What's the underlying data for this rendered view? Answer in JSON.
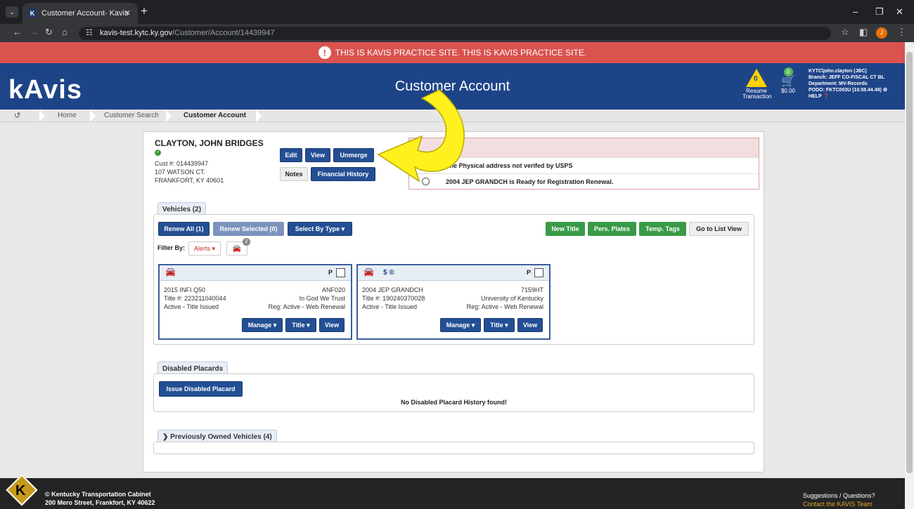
{
  "browser": {
    "tab_title": "Customer Account- Kavis",
    "tab_icon": "KAVIS",
    "url_domain": "kavis-test.kytc.ky.gov",
    "url_path": "/Customer/Account/14439947"
  },
  "banner": {
    "text": "THIS IS KAVIS PRACTICE SITE. THIS IS KAVIS PRACTICE SITE."
  },
  "header": {
    "logo": "kAvis",
    "title": "Customer Account",
    "resume_count": "0",
    "resume_label": "Resume Transaction",
    "cart_count": "0",
    "cart_total": "$0.00",
    "user_line1": "KYTC\\john.clayton (JBC)",
    "user_line2": "Branch: JEFF CO-FISCAL CT BL",
    "user_line3": "Department: MV-Records",
    "user_line4": "PODO: FKTC003U (10.58.44.49)",
    "help": "HELP"
  },
  "breadcrumb": {
    "home": "Home",
    "search": "Customer Search",
    "current": "Customer Account"
  },
  "customer": {
    "name": "CLAYTON, JOHN BRIDGES",
    "cust_no": "Cust #: 014439947",
    "address1": "107 WATSON CT.",
    "address2": "FRANKFORT, KY 40601"
  },
  "actions": {
    "edit": "Edit",
    "view": "View",
    "unmerge": "Unmerge",
    "notes": "Notes",
    "financial": "Financial History"
  },
  "alerts": [
    "The Physical address not verifed by USPS",
    "2004 JEP GRANDCH is Ready for Registration Renewal."
  ],
  "vehicles": {
    "tab_label": "Vehicles (2)",
    "renew_all": "Renew All (1)",
    "renew_selected": "Renew Selected (0)",
    "select_by_type": "Select By Type",
    "new_title": "New Title",
    "pers_plates": "Pers. Plates",
    "temp_tags": "Temp. Tags",
    "list_view": "Go to List View",
    "filter_label": "Filter By:",
    "filter_alerts": "Alerts",
    "filter_count": "2",
    "cards": [
      {
        "model": "2015 INFI Q50",
        "plate": "ANF020",
        "title_no": "Title #: 223211040044",
        "plate_type": "In God We Trust",
        "status": "Active - Title Issued",
        "reg": "Reg: Active - Web Renewal",
        "flag": "P",
        "extra": ""
      },
      {
        "model": "2004 JEP GRANDCH",
        "plate": "7159HT",
        "title_no": "Title #: 190240370028",
        "plate_type": "University of Kentucky",
        "status": "Active - Title Issued",
        "reg": "Reg: Active - Web Renewal",
        "flag": "P",
        "extra": "$ ®"
      }
    ],
    "manage": "Manage",
    "title_btn": "Title",
    "view_btn": "View"
  },
  "placards": {
    "tab_label": "Disabled Placards",
    "issue": "Issue Disabled Placard",
    "empty": "No Disabled Placard History found!"
  },
  "previous": {
    "tab_label": "Previously Owned Vehicles (4)"
  },
  "footer": {
    "org": "© Kentucky Transportation Cabinet",
    "address": "200 Mero Street, Frankfort, KY 40622",
    "suggest": "Suggestions / Questions?",
    "contact": "Contact the KAVIS Team"
  }
}
